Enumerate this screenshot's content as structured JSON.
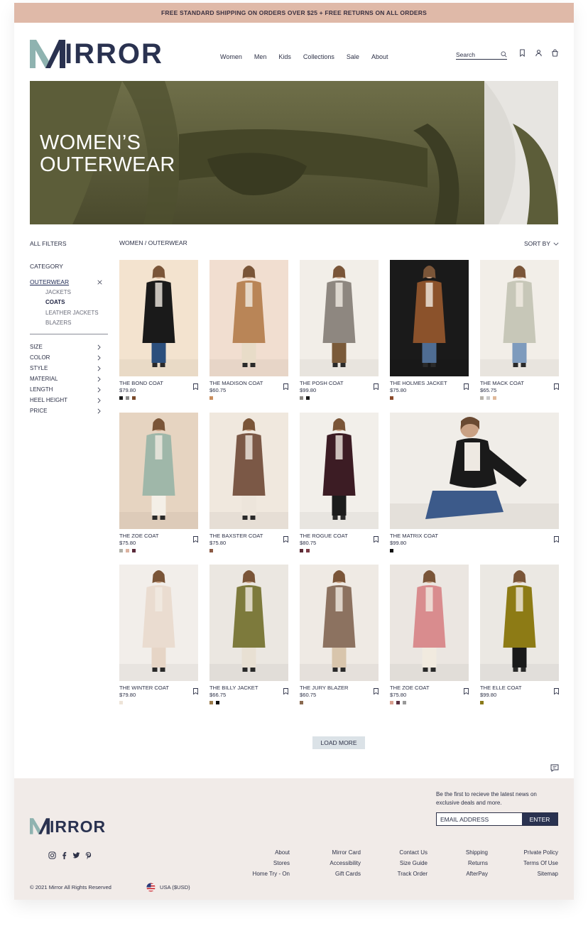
{
  "promo": "FREE STANDARD SHIPPING ON ORDERS OVER $25 + FREE RETURNS ON ALL ORDERS",
  "brand": {
    "initial": "M",
    "rest": "IRROR"
  },
  "nav": [
    "Women",
    "Men",
    "Kids",
    "Collections",
    "Sale",
    "About"
  ],
  "search": {
    "label": "Search"
  },
  "header_icons": [
    "search-icon",
    "bookmark-icon",
    "user-icon",
    "bag-icon"
  ],
  "hero": {
    "line1": "WOMEN’S",
    "line2": "OUTERWEAR"
  },
  "sidebar": {
    "all_filters": "ALL FILTERS",
    "category": "CATEGORY",
    "selected": "OUTERWEAR",
    "subcategories": [
      {
        "label": "JACKETS",
        "active": false
      },
      {
        "label": "COATS",
        "active": true
      },
      {
        "label": "LEATHER JACKETS",
        "active": false
      },
      {
        "label": "BLAZERS",
        "active": false
      }
    ],
    "filters": [
      "SIZE",
      "COLOR",
      "STYLE",
      "MATERIAL",
      "LENGTH",
      "HEEL HEIGHT",
      "PRICE"
    ]
  },
  "breadcrumb": "WOMEN / OUTERWEAR",
  "sort_label": "SORT BY",
  "products": [
    {
      "name": "THE BOND COAT",
      "price": "$79.80",
      "swatches": [
        "#1b1b1b",
        "#8a8a8a",
        "#7a4a2a"
      ],
      "colors": [
        "#1a1a1a",
        "#2c4f7c",
        "#f3e3cf"
      ]
    },
    {
      "name": "THE MADISON COAT",
      "price": "$60.75",
      "swatches": [
        "#c98e5e"
      ],
      "colors": [
        "#b98557",
        "#e8dcc8",
        "#f1ded0"
      ]
    },
    {
      "name": "THE POSH COAT",
      "price": "$99.80",
      "swatches": [
        "#8d8a85",
        "#1b1b1b"
      ],
      "colors": [
        "#8e8780",
        "#7a5a3a",
        "#f2eee8"
      ]
    },
    {
      "name": "THE HOLMES JACKET",
      "price": "$75.80",
      "swatches": [
        "#8b4a2a"
      ],
      "colors": [
        "#8b522b",
        "#4f6d93",
        "#1a1a1a"
      ]
    },
    {
      "name": "THE MACK COAT",
      "price": "$65.75",
      "swatches": [
        "#b7b3aa",
        "#c8c8c8",
        "#e0b99a"
      ],
      "colors": [
        "#c7c7b8",
        "#7e9bbd",
        "#f2eee8"
      ]
    },
    {
      "name": "THE ZOE COAT",
      "price": "$75.80",
      "swatches": [
        "#b0b0a8",
        "#dcb2a0",
        "#5a2a3a"
      ],
      "colors": [
        "#9fb7a9",
        "#f4efe7",
        "#e6d4c1"
      ]
    },
    {
      "name": "THE BAXSTER COAT",
      "price": "$75.80",
      "swatches": [
        "#8b5a45"
      ],
      "colors": [
        "#7b5846",
        "#ede5db",
        "#f0e8de"
      ]
    },
    {
      "name": "THE ROGUE COAT",
      "price": "$80.75",
      "swatches": [
        "#5a2a35",
        "#7a3a45"
      ],
      "colors": [
        "#3c1c24",
        "#1c1c1c",
        "#f2efea"
      ]
    },
    {
      "name": "THE MATRIX COAT",
      "price": "$99.80",
      "swatches": [
        "#111111"
      ],
      "colors": [
        "#1a1a1a",
        "#3c5a8a",
        "#f0ede8"
      ]
    },
    {
      "name": "THE WINTER COAT",
      "price": "$79.80",
      "swatches": [
        "#eee4d8"
      ],
      "colors": [
        "#eadcd0",
        "#e6d5c6",
        "#f2eeea"
      ]
    },
    {
      "name": "THE BILLY JACKET",
      "price": "$66.75",
      "swatches": [
        "#9a7a4a",
        "#111111"
      ],
      "colors": [
        "#7d7a3c",
        "#e8e0d3",
        "#ebe7e1"
      ]
    },
    {
      "name": "THE JURY BLAZER",
      "price": "$60.75",
      "swatches": [
        "#8a6a50"
      ],
      "colors": [
        "#8c7260",
        "#d8c5ac",
        "#efeae4"
      ]
    },
    {
      "name": "THE ZOE COAT",
      "price": "$75.80",
      "swatches": [
        "#d8a090",
        "#5a3040",
        "#9a9a9a"
      ],
      "colors": [
        "#d98c8e",
        "#f1eadf",
        "#ebe6e1"
      ]
    },
    {
      "name": "THE ELLE COAT",
      "price": "$99.80",
      "swatches": [
        "#8a7a1a"
      ],
      "colors": [
        "#8d7b15",
        "#1a1a1a",
        "#ebe8e3"
      ]
    }
  ],
  "load_more": "LOAD MORE",
  "footer": {
    "newsletter": "Be the first to recieve the latest news on exclusive deals and more.",
    "email_placeholder": "EMAIL ADDRESS",
    "enter": "ENTER",
    "social_icons": [
      "instagram-icon",
      "facebook-icon",
      "twitter-icon",
      "pinterest-icon"
    ],
    "columns": [
      [
        "About",
        "Stores",
        "Home Try - On"
      ],
      [
        "Mirror Card",
        "Accessibility",
        "Gift Cards"
      ],
      [
        "Contact Us",
        "Size Guide",
        "Track Order"
      ],
      [
        "Shipping",
        "Returns",
        "AfterPay"
      ],
      [
        "Private Policy",
        "Terms Of Use",
        "Sitemap"
      ]
    ],
    "copyright": "© 2021 Mirror All Rights  Reserved",
    "locale": "USA ($USD)"
  },
  "colors": {
    "promo_bg": "#dfb9a8",
    "navy": "#2a3250",
    "teal": "#8fb3b0",
    "footer_bg": "#f1ebe8",
    "load_bg": "#dbe2e7"
  }
}
